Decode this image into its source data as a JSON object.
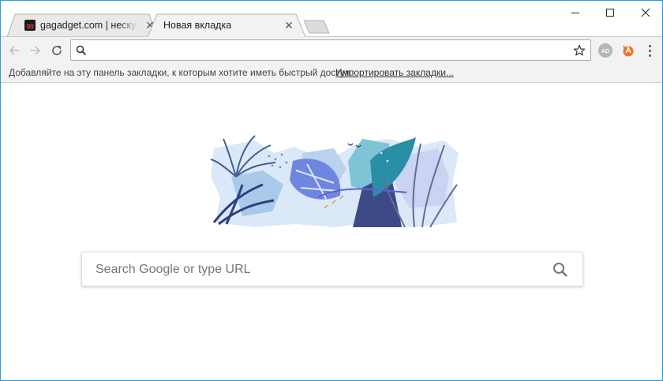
{
  "tabs": [
    {
      "title": "gagadget.com | нескучные новости",
      "favicon_text": "gg",
      "active": false
    },
    {
      "title": "Новая вкладка",
      "active": true
    }
  ],
  "omnibox": {
    "value": "",
    "placeholder": ""
  },
  "extensions": {
    "adblock_label": "AD"
  },
  "bookmarks_bar": {
    "message": "Добавляйте на эту панель закладки, к которым хотите иметь быстрый доступ.",
    "import_link": "Импортировать закладки..."
  },
  "new_tab_page": {
    "search_placeholder": "Search Google or type URL"
  },
  "colors": {
    "window_border": "#2b9bd6",
    "toolbar_bg": "#f2f2f2",
    "avast_orange": "#f37021"
  }
}
